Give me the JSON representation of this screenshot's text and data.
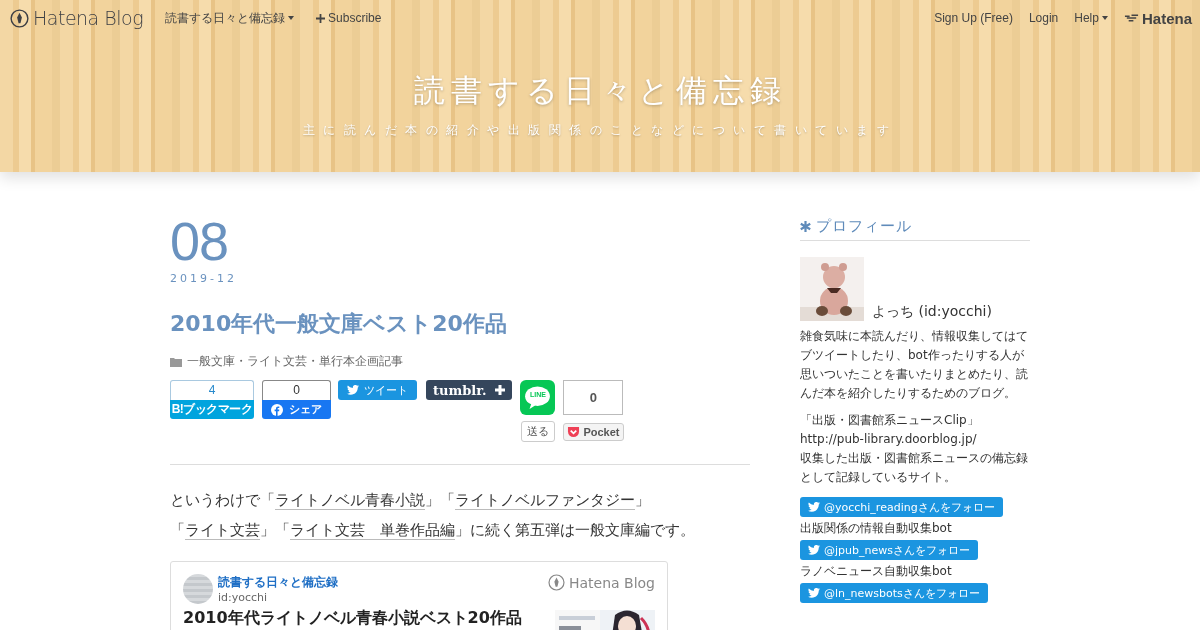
{
  "topbar": {
    "logo": "Hatena Blog",
    "blog_menu": "読書する日々と備忘録",
    "subscribe": "Subscribe",
    "links": [
      "Sign Up (Free)",
      "Login"
    ],
    "help": "Help",
    "hatena": "Hatena"
  },
  "header": {
    "title": "読書する日々と備忘録",
    "description": "主に読んだ本の紹介や出版関係のことなどについて書いています"
  },
  "article": {
    "day": "08",
    "month": "2019-12",
    "title": "2010年代一般文庫ベスト20作品",
    "category": "一般文庫・ライト文芸・単行本企画記事",
    "share": {
      "bookmark_count": "4",
      "bookmark": "B!ブックマーク",
      "facebook_count": "0",
      "facebook": "シェア",
      "tweet": "ツイート",
      "tumblr": "tumblr.",
      "line": "LINE",
      "line_send": "送る",
      "pocket_count": "0",
      "pocket": "Pocket"
    },
    "body": [
      {
        "text": "というわけで「",
        "link": false
      },
      {
        "text": "ライトノベル青春小説",
        "link": true
      },
      {
        "text": "」「",
        "link": false
      },
      {
        "text": "ライトノベルファンタジー",
        "link": true
      },
      {
        "text": "」「",
        "link": false
      },
      {
        "text": "ライト文芸",
        "link": true
      },
      {
        "text": "」「",
        "link": false
      },
      {
        "text": "ライト文芸　単巻作品編",
        "link": true
      },
      {
        "text": "」に続く第五弾は一般文庫編です。",
        "link": false
      }
    ],
    "embed": {
      "blog": "読書する日々と備忘録",
      "author": "id:yocchi",
      "brand": "Hatena Blog",
      "title": "2010年代ライトノベル青春小説ベスト20作品"
    }
  },
  "sidebar": {
    "heading": "プロフィール",
    "name": "よっち (id:yocchi)",
    "bio": "雑食気味に本読んだり、情報収集してはてブツイートしたり、bot作ったりする人が思いついたことを書いたりまとめたり、読んだ本を紹介したりするためのブログ。",
    "about": [
      "「出版・図書館系ニュースClip」",
      "http://pub-library.doorblog.jp/",
      "収集した出版・図書館系ニュースの備忘録として記録しているサイト。"
    ],
    "follow_items": [
      {
        "kind": "button",
        "text": "@yocchi_readingさんをフォロー"
      },
      {
        "kind": "caption",
        "text": "出版関係の情報自動収集bot"
      },
      {
        "kind": "button",
        "text": "@jpub_newsさんをフォロー"
      },
      {
        "kind": "caption",
        "text": "ラノベニュース自動収集bot"
      },
      {
        "kind": "button",
        "text": "@ln_newsbotsさんをフォロー"
      }
    ]
  }
}
